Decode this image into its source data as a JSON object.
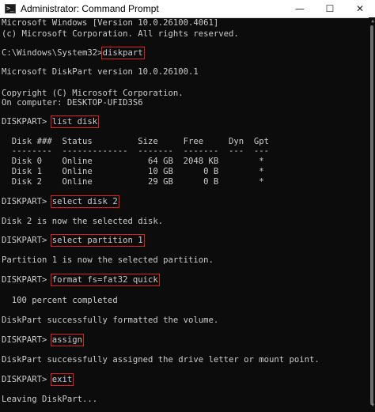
{
  "window": {
    "title": "Administrator: Command Prompt",
    "icon": "cmd-icon",
    "controls": {
      "minimize": "—",
      "maximize": "☐",
      "close": "✕"
    }
  },
  "console": {
    "lines": [
      "Microsoft Windows [Version 10.0.26100.4061]",
      "(c) Microsoft Corporation. All rights reserved.",
      "",
      "C:\\Windows\\System32>",
      "",
      "Microsoft DiskPart version 10.0.26100.1",
      "",
      "Copyright (C) Microsoft Corporation.",
      "On computer: DESKTOP-UFID3S6",
      "",
      "DISKPART> ",
      "",
      "  Disk ###  Status         Size     Free     Dyn  Gpt",
      "  --------  -------------  -------  -------  ---  ---",
      "  Disk 0    Online           64 GB  2048 KB        *",
      "  Disk 1    Online           10 GB      0 B        *",
      "  Disk 2    Online           29 GB      0 B        *",
      "",
      "DISKPART> ",
      "",
      "Disk 2 is now the selected disk.",
      "",
      "DISKPART> ",
      "",
      "Partition 1 is now the selected partition.",
      "",
      "DISKPART> ",
      "",
      "  100 percent completed",
      "",
      "DiskPart successfully formatted the volume.",
      "",
      "DISKPART> ",
      "",
      "DiskPart successfully assigned the drive letter or mount point.",
      "",
      "DISKPART> ",
      "",
      "Leaving DiskPart..."
    ],
    "commands": {
      "diskpart": "diskpart",
      "list_disk": "list disk",
      "select_disk": "select disk 2",
      "select_partition": "select partition 1",
      "format": "format fs=fat32 quick",
      "assign": "assign",
      "exit": "exit"
    }
  }
}
